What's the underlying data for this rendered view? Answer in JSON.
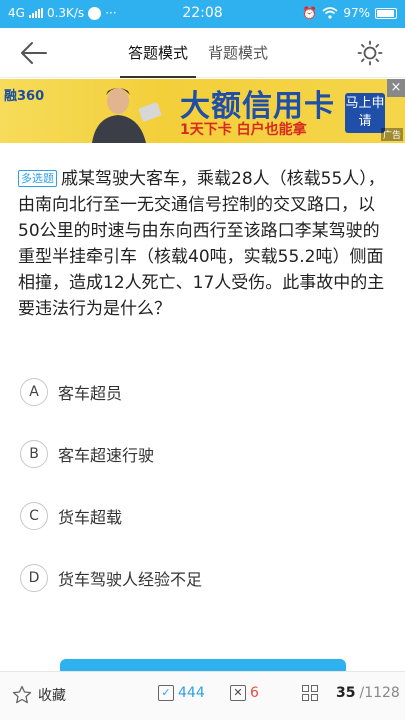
{
  "status_bar": {
    "network": "4G",
    "speed": "0.3K/s",
    "time": "22:08",
    "battery": "97%",
    "color": "#2fb1ef"
  },
  "header": {
    "back_icon": "arrow-left-icon",
    "tabs": [
      {
        "label": "答题模式",
        "active": true
      },
      {
        "label": "背题模式",
        "active": false
      }
    ],
    "theme_icon": "sun-icon"
  },
  "ad": {
    "logo": "融360",
    "title": "大额信用卡",
    "subtitle": "1天下卡 白户也能拿",
    "button": "马上申请",
    "close": "×",
    "tag": "广告"
  },
  "question": {
    "type_tag": "多选题",
    "text": "戚某驾驶大客车，乘载28人（核载55人），由南向北行至一无交通信号控制的交叉路口，以50公里的时速与由东向西行至该路口李某驾驶的重型半挂牵引车（核载40吨，实载55.2吨）侧面相撞，造成12人死亡、17人受伤。此事故中的主要违法行为是什么？"
  },
  "options": [
    {
      "letter": "A",
      "text": "客车超员"
    },
    {
      "letter": "B",
      "text": "客车超速行驶"
    },
    {
      "letter": "C",
      "text": "货车超载"
    },
    {
      "letter": "D",
      "text": "货车驾驶人经验不足"
    }
  ],
  "bottom_bar": {
    "favorite_label": "收藏",
    "correct_count": "444",
    "wrong_count": "6",
    "current": "35",
    "total": "/1128",
    "correct_color": "#2fa0e6",
    "wrong_color": "#e84c3d"
  }
}
